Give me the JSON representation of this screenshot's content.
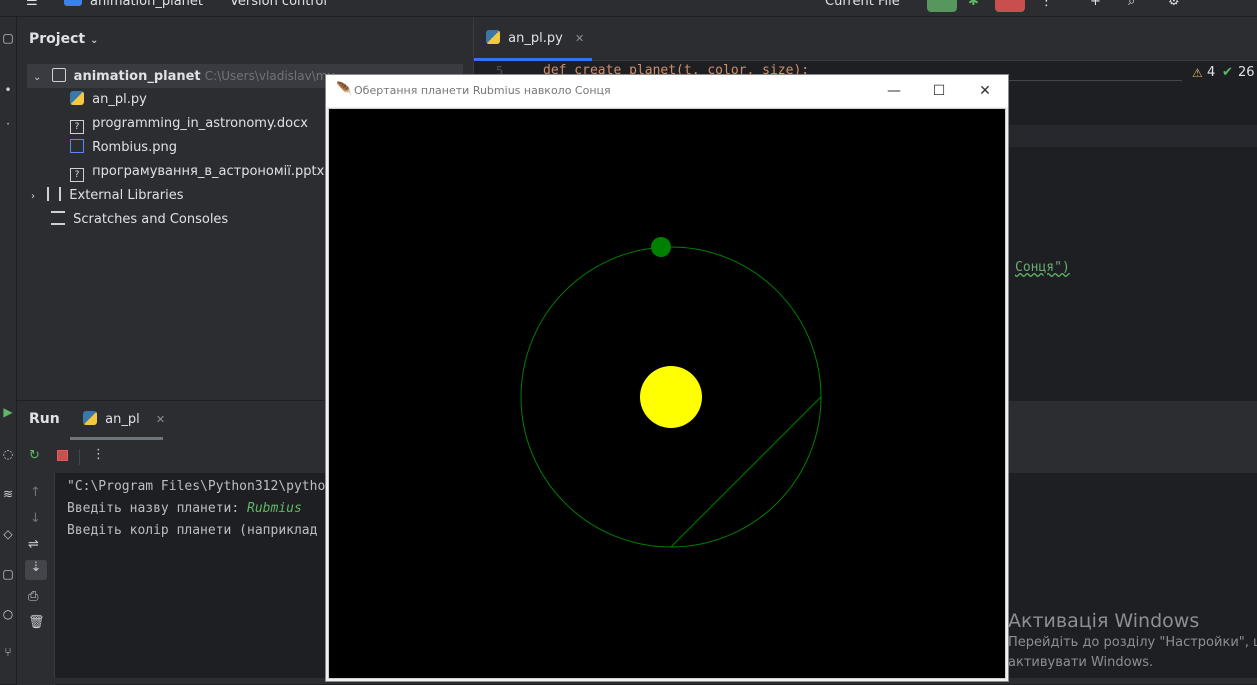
{
  "topbar": {
    "project_name": "animation_planet",
    "vcs": "Version control",
    "run_config": "Current File"
  },
  "project_pane": {
    "title": "Project",
    "root_name": "animation_planet",
    "root_path": "C:\\Users\\vladislav\\my_...",
    "files": [
      {
        "name": "an_pl.py",
        "type": "python"
      },
      {
        "name": "programming_in_astronomy.docx",
        "type": "unknown"
      },
      {
        "name": "Rombius.png",
        "type": "image"
      },
      {
        "name": "програмування_в_астрономії.pptx",
        "type": "unknown"
      }
    ],
    "external_libraries": "External Libraries",
    "scratches": "Scratches and Consoles"
  },
  "editor": {
    "tab_name": "an_pl.py",
    "line_number": "5",
    "code_line": "def create_planet(t, color, size):",
    "warnings_count": "4",
    "checks_count": "26",
    "string_fragment": "Сонця\")"
  },
  "run_panel": {
    "title": "Run",
    "tab_name": "an_pl",
    "console_lines": [
      {
        "text": "\"C:\\Program Files\\Python312\\pytho",
        "user": ""
      },
      {
        "text": "Введіть назву планети: ",
        "user": "Rubmius"
      },
      {
        "text": "Введіть колір планети (наприклад",
        "user": ""
      }
    ]
  },
  "tk_window": {
    "title": "Обертання планети Rubmius навколо Сонця",
    "minimize": "—",
    "maximize": "☐",
    "close": "✕"
  },
  "canvas": {
    "background": "#000000",
    "sun_color": "#ffff00",
    "planet_color": "#008000",
    "orbit_color": "#008000"
  },
  "activation": {
    "title": "Активація Windows",
    "line1": "Перейдіть до розділу \"Настройки\", щ",
    "line2": "активувати Windows."
  }
}
